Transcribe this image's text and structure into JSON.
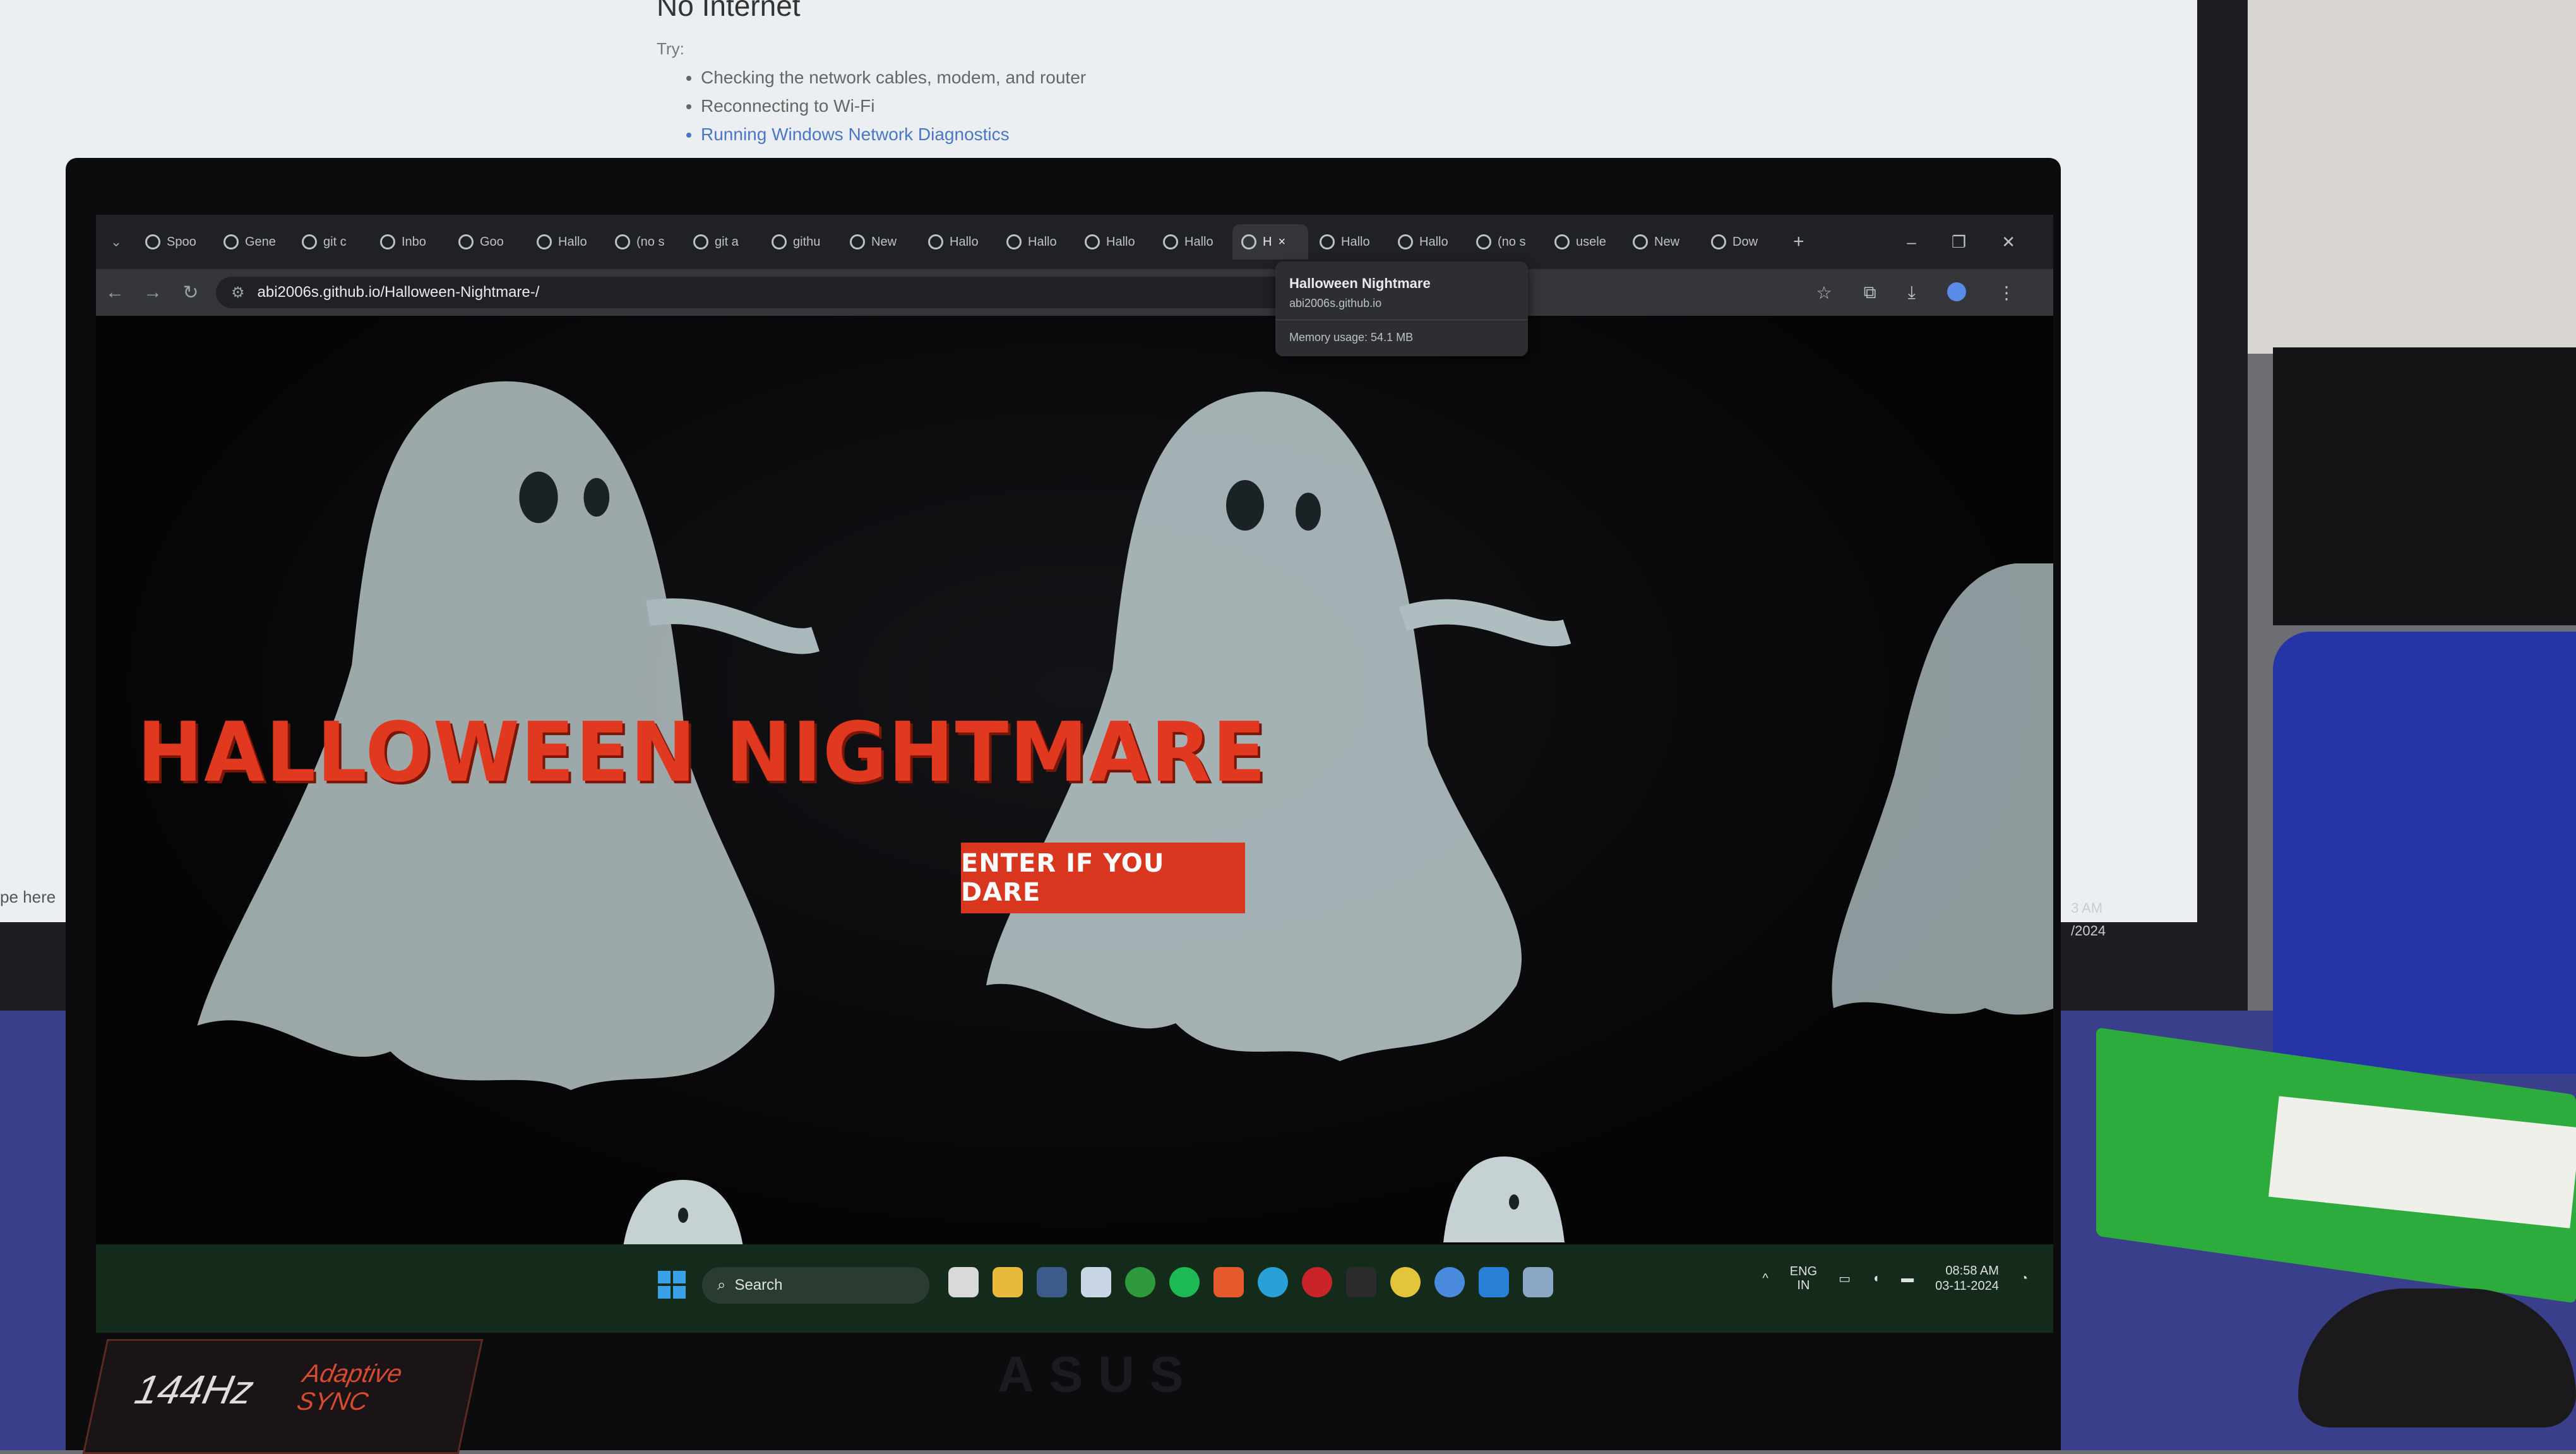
{
  "background": {
    "heading": "No Internet",
    "try_label": "Try:",
    "suggestions": [
      "Checking the network cables, modem, and router",
      "Reconnecting to Wi-Fi",
      "Running Windows Network Diagnostics"
    ],
    "type_here": "pe here",
    "clock_time": "3 AM",
    "clock_date": "/2024"
  },
  "browser": {
    "tabs": [
      {
        "label": "Spoo",
        "icon": "spotify-icon"
      },
      {
        "label": "Gene",
        "icon": "chatgpt-icon"
      },
      {
        "label": "git c",
        "icon": "chatgpt-icon"
      },
      {
        "label": "Inbo",
        "icon": "gmail-icon"
      },
      {
        "label": "Goo",
        "icon": "chatgpt-icon"
      },
      {
        "label": "Hallo",
        "icon": "github-pages-icon"
      },
      {
        "label": "(no s",
        "icon": "gmail-icon"
      },
      {
        "label": "git a",
        "icon": "chatgpt-icon"
      },
      {
        "label": "githu",
        "icon": "git-icon"
      },
      {
        "label": "New",
        "icon": "chatgpt-icon"
      },
      {
        "label": "Hallo",
        "icon": "github-pages-icon"
      },
      {
        "label": "Hallo",
        "icon": "github-pages-icon"
      },
      {
        "label": "Hallo",
        "icon": "github-pages-icon"
      },
      {
        "label": "Hallo",
        "icon": "github-pages-icon"
      },
      {
        "label": "H",
        "icon": "github-pages-icon",
        "active": true
      },
      {
        "label": "Hallo",
        "icon": "github-pages-icon"
      },
      {
        "label": "Hallo",
        "icon": "github-pages-icon"
      },
      {
        "label": "(no s",
        "icon": "gmail-icon"
      },
      {
        "label": "usele",
        "icon": "github-icon"
      },
      {
        "label": "New",
        "icon": "chatgpt-icon"
      },
      {
        "label": "Dow",
        "icon": "download-icon"
      }
    ],
    "url": "abi2006s.github.io/Halloween-Nightmare-/",
    "tooltip": {
      "title": "Halloween Nightmare",
      "url": "abi2006s.github.io",
      "memory": "Memory usage: 54.1 MB"
    }
  },
  "page": {
    "title": "HALLOWEEN NIGHTMARE",
    "button_label": "ENTER IF YOU DARE"
  },
  "taskbar": {
    "search_label": "Search",
    "lang_top": "ENG",
    "lang_bottom": "IN",
    "time": "08:58 AM",
    "date": "03-11-2024"
  },
  "laptop": {
    "brand": "ASUS",
    "sticker_hz": "144Hz",
    "sticker_line1": "Adaptive",
    "sticker_line2": "SYNC"
  },
  "colors": {
    "title_red": "#e0391f",
    "button_red": "#d8361f",
    "chrome_dark": "#202124"
  }
}
